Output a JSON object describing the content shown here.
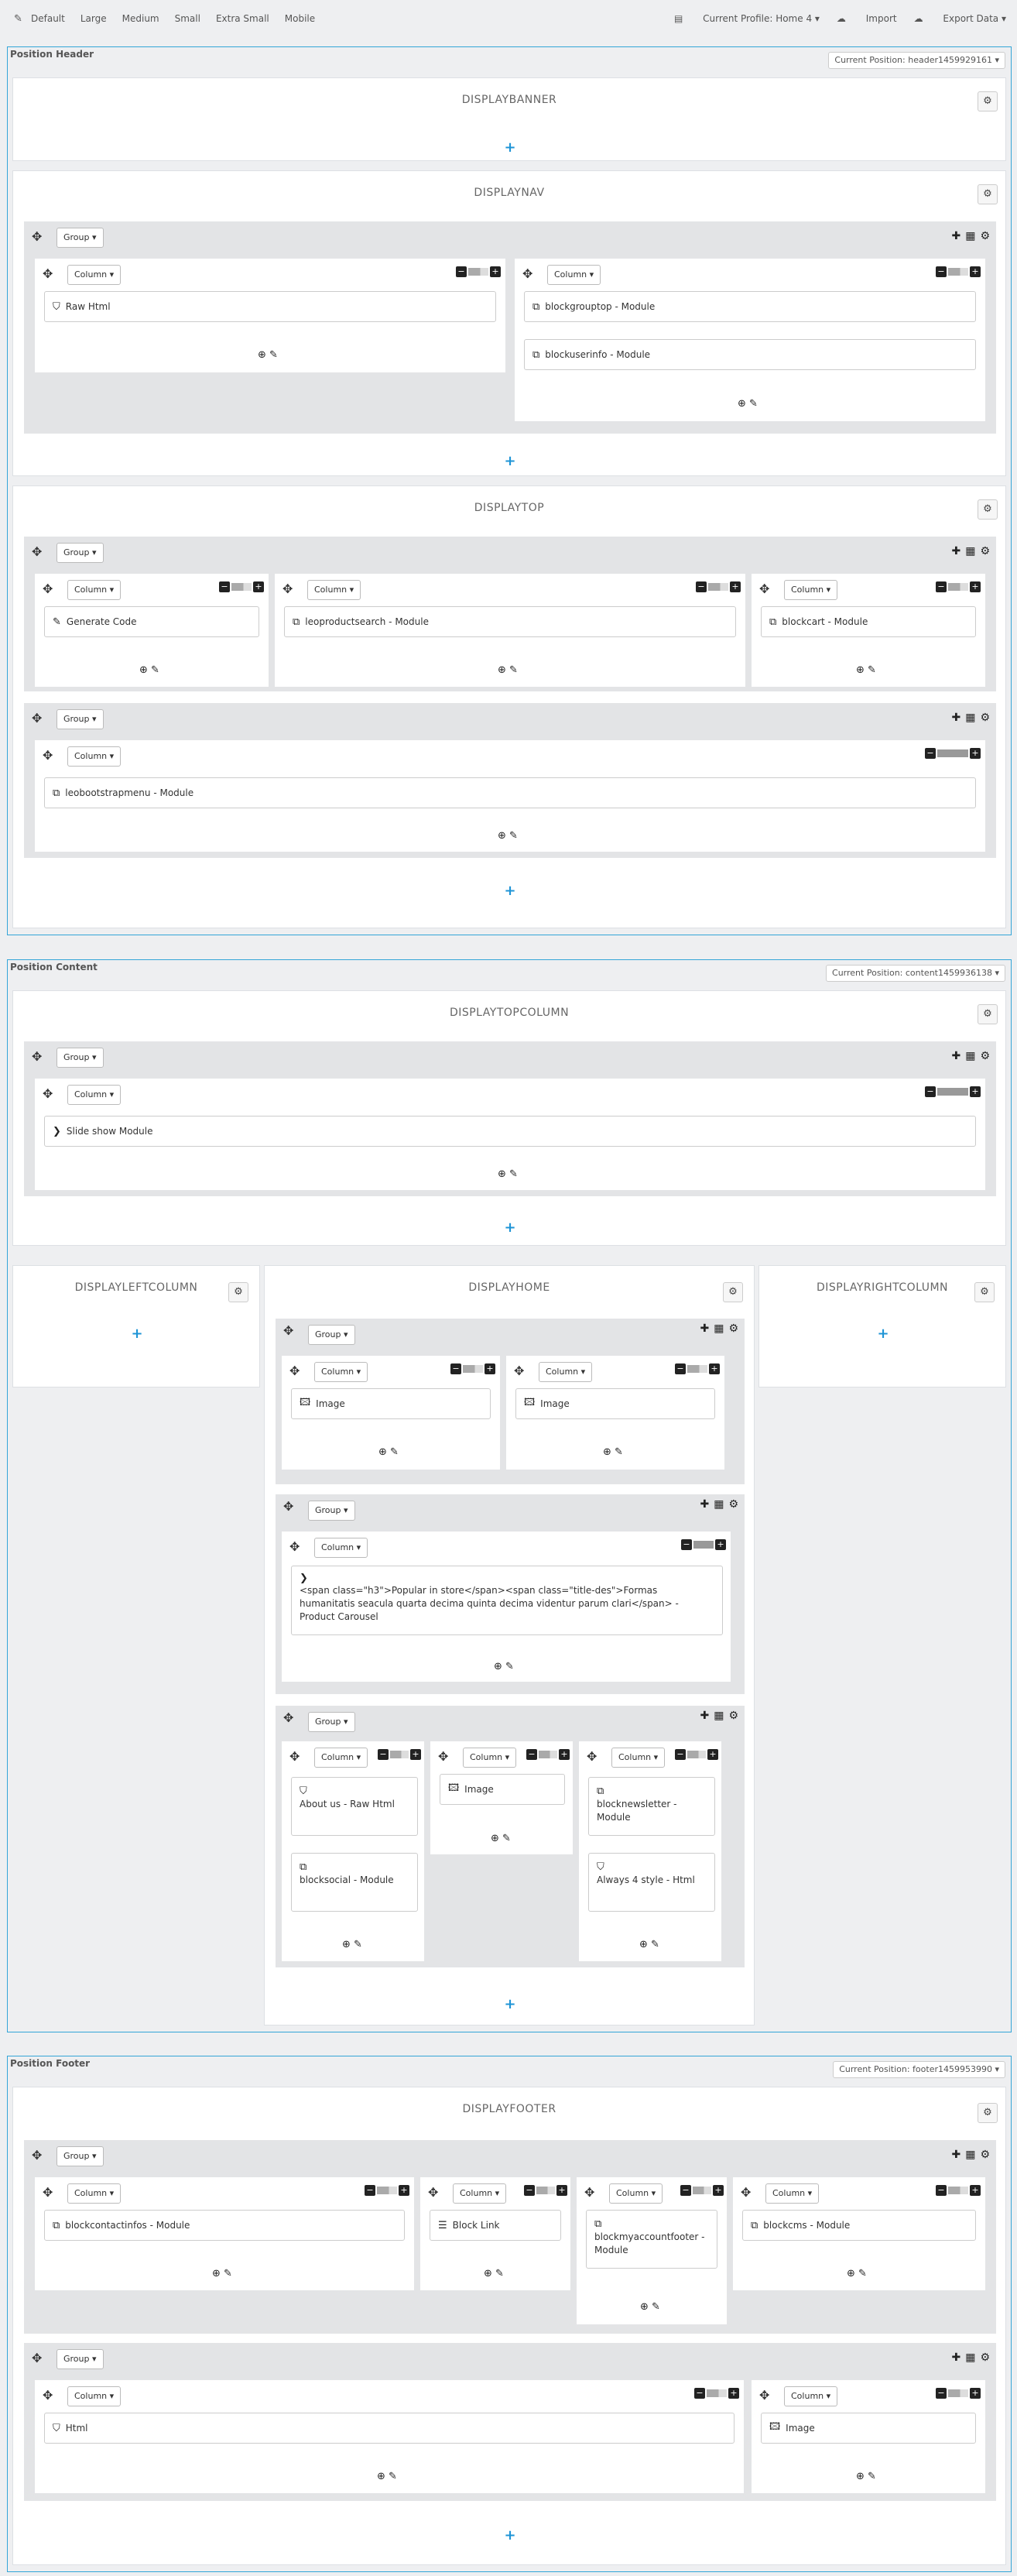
{
  "toolbar": {
    "devices": [
      "Default",
      "Large",
      "Medium",
      "Small",
      "Extra Small",
      "Mobile"
    ],
    "profile": "Current Profile: Home 4 ▾",
    "import": "Import",
    "export": "Export Data ▾"
  },
  "header": {
    "title": "Position Header",
    "current": "Current Position: header1459929161 ▾",
    "hooks": {
      "banner": "DISPLAYBANNER",
      "nav": "DISPLAYNAV",
      "top": "DISPLAYTOP"
    }
  },
  "content": {
    "title": "Position Content",
    "current": "Current Position: content1459936138 ▾",
    "hooks": {
      "topcolumn": "DISPLAYTOPCOLUMN",
      "left": "DISPLAYLEFTCOLUMN",
      "home": "DISPLAYHOME",
      "right": "DISPLAYRIGHTCOLUMN"
    }
  },
  "footer": {
    "title": "Position Footer",
    "current": "Current Position: footer1459953990 ▾",
    "hooks": {
      "footer": "DISPLAYFOOTER"
    }
  },
  "labels": {
    "group": "Group ▾",
    "column": "Column ▾",
    "add": "+"
  },
  "widgets": {
    "raw_html": "Raw Html",
    "blockgrouptop": "blockgrouptop - Module",
    "blockuserinfo": "blockuserinfo - Module",
    "generate_code": "Generate Code",
    "leoproductsearch": "leoproductsearch - Module",
    "blockcart": "blockcart - Module",
    "leobootstrapmenu": "leobootstrapmenu - Module",
    "slideshow": "Slide show Module",
    "image": "Image",
    "carousel": "<span class=\"h3\">Popular in store</span><span class=\"title-des\">Formas humanitatis seacula quarta decima quinta decima videntur parum clari</span> - Product Carousel",
    "about_us": "About us - Raw Html",
    "blocksocial": "blocksocial - Module",
    "blocknewsletter": "blocknewsletter - Module",
    "always4": "Always 4 style - Html",
    "blockcontactinfos": "blockcontactinfos - Module",
    "block_link": "Block Link",
    "blockmyaccountfooter": "blockmyaccountfooter - Module",
    "blockcms": "blockcms - Module",
    "html": "Html"
  },
  "icons": {
    "move": "move-icon",
    "gear": "gear-icon",
    "html": "html5-icon",
    "module": "module-icon",
    "image": "image-icon",
    "chevron": "chevron-right-icon",
    "list": "list-icon",
    "edit": "edit-icon"
  }
}
